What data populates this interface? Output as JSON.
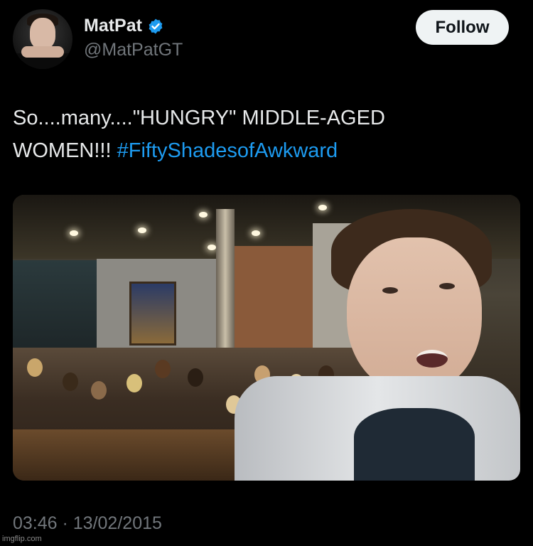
{
  "author": {
    "display_name": "MatPat",
    "handle": "@MatPatGT",
    "verified": true,
    "avatar_icon": "profile-photo"
  },
  "follow_button": {
    "label": "Follow"
  },
  "tweet": {
    "text_line1": "So....many....\"HUNGRY\" MIDDLE-AGED",
    "text_line2_prefix": "WOMEN!!! ",
    "hashtag": "#FiftyShadesofAwkward",
    "timestamp": "03:46 · 13/02/2015"
  },
  "media": {
    "type": "photo"
  },
  "watermark": {
    "text": "imgflip.com"
  },
  "colors": {
    "background": "#000000",
    "text": "#e7e9ea",
    "secondary_text": "#71767b",
    "link": "#1d9bf0",
    "verified_badge": "#1d9bf0",
    "follow_button_bg": "#eff3f4"
  }
}
